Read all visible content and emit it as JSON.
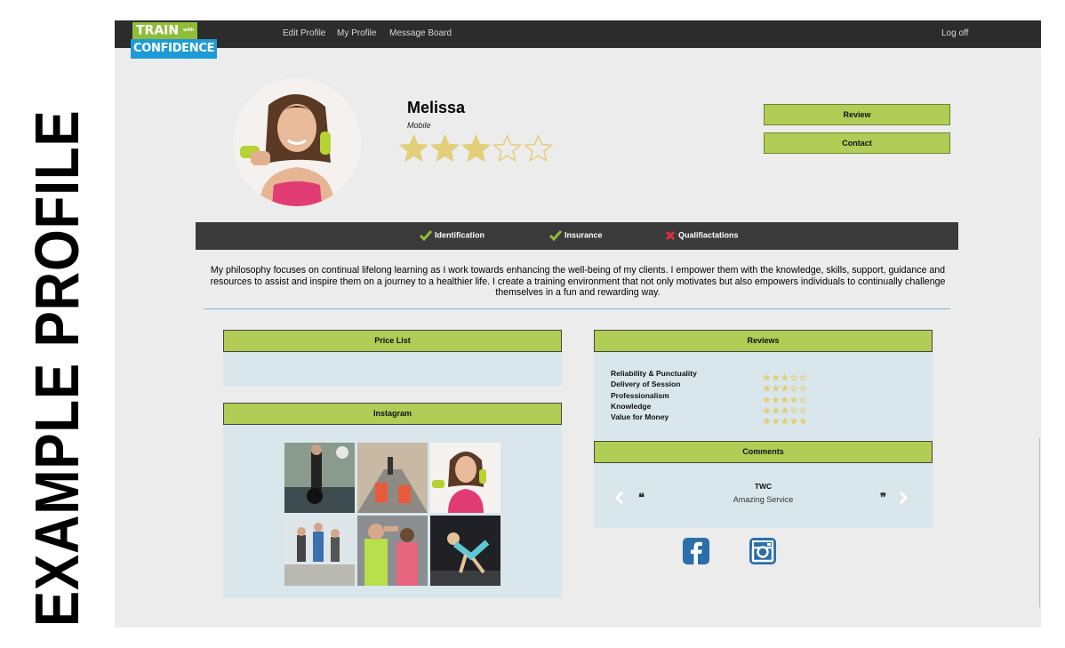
{
  "side_title": "EXAMPLE PROFILE",
  "logo": {
    "line1": "TRAIN",
    "with": "with",
    "line2": "CONFIDENCE"
  },
  "nav": {
    "edit_profile": "Edit Profile",
    "my_profile": "My Profile",
    "message_board": "Message Board",
    "log_off": "Log off"
  },
  "profile": {
    "name": "Melissa",
    "subtitle": "Mobile",
    "rating": 3,
    "rating_max": 5
  },
  "buttons": {
    "review": "Review",
    "contact": "Contact"
  },
  "verification": [
    {
      "label": "Identification",
      "status": "verified"
    },
    {
      "label": "Insurance",
      "status": "verified"
    },
    {
      "label": "Qualifiactations",
      "status": "missing"
    }
  ],
  "philosophy": "My philosophy focuses on continual lifelong learning as I work towards enhancing the well-being of my clients. I empower them with the knowledge, skills, support, guidance and resources to assist and inspire them on a journey to a healthier life. I create a training environment that not only motivates but also empowers individuals to continually challenge themselves in a fun and rewarding way.",
  "panels": {
    "price_list": "Price List",
    "instagram": "Instagram",
    "reviews": "Reviews",
    "comments": "Comments"
  },
  "reviews": [
    {
      "label": "Reliability & Punctuality",
      "stars": 3
    },
    {
      "label": "Delivery of Session",
      "stars": 3
    },
    {
      "label": "Professionalism",
      "stars": 4
    },
    {
      "label": "Knowledge",
      "stars": 3
    },
    {
      "label": "Value for Money",
      "stars": 5
    }
  ],
  "comment": {
    "name": "TWC",
    "text": "Amazing Service",
    "open_quote": "❝",
    "close_quote": "❞"
  },
  "colors": {
    "accent_green": "#b1cd55",
    "star": "#e3cf7a",
    "topbar": "#2c2c2c",
    "panel_bg": "#d9e7ec",
    "facebook": "#2b6ea8",
    "instagram": "#2b6ea8",
    "check": "#8fbd3a",
    "cross": "#e0303c"
  },
  "icons": {
    "verified": "check-icon",
    "missing": "cross-icon",
    "social": [
      "facebook-icon",
      "instagram-icon"
    ]
  }
}
